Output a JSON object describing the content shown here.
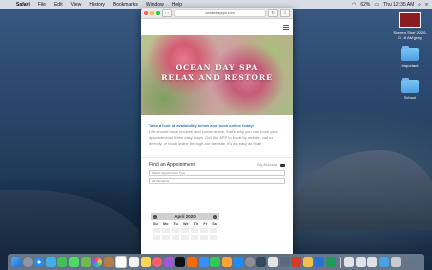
{
  "menubar": {
    "items": [
      "Safari",
      "File",
      "Edit",
      "View",
      "History",
      "Bookmarks",
      "Window",
      "Help"
    ],
    "battery": "62%",
    "clock": "Thu 12:35 AM"
  },
  "desktop_icons": [
    {
      "label": "Screen Shot 2020-0...8 AM.jpeg",
      "kind": "thumbnail"
    },
    {
      "label": "Important",
      "kind": "folder"
    },
    {
      "label": "School",
      "kind": "folder"
    }
  ],
  "browser": {
    "url": "oceandayspa.com",
    "hero_line1": "OCEAN DAY SPA",
    "hero_line2": "RELAX AND RESTORE",
    "lead": "Take a look at availability below and book online today!",
    "body": "Life should have choices and convenience, that's why you can book your appointments three easy ways. Get the APP to book by mobile, call us directly, or book online through our website. It's as easy as that!",
    "find_title": "Find an Appointment",
    "my_account": "My Account",
    "select1": "Select Appointment Type",
    "select2": "All therapists",
    "calendar_month": "April 2020",
    "weekdays": [
      "Su",
      "Mo",
      "Tu",
      "We",
      "Th",
      "Fr",
      "Sa"
    ]
  },
  "colors": {
    "accent_link": "#3a78b5",
    "traffic_red": "#fe5f57",
    "traffic_yellow": "#febc2e",
    "traffic_green": "#28c840"
  }
}
